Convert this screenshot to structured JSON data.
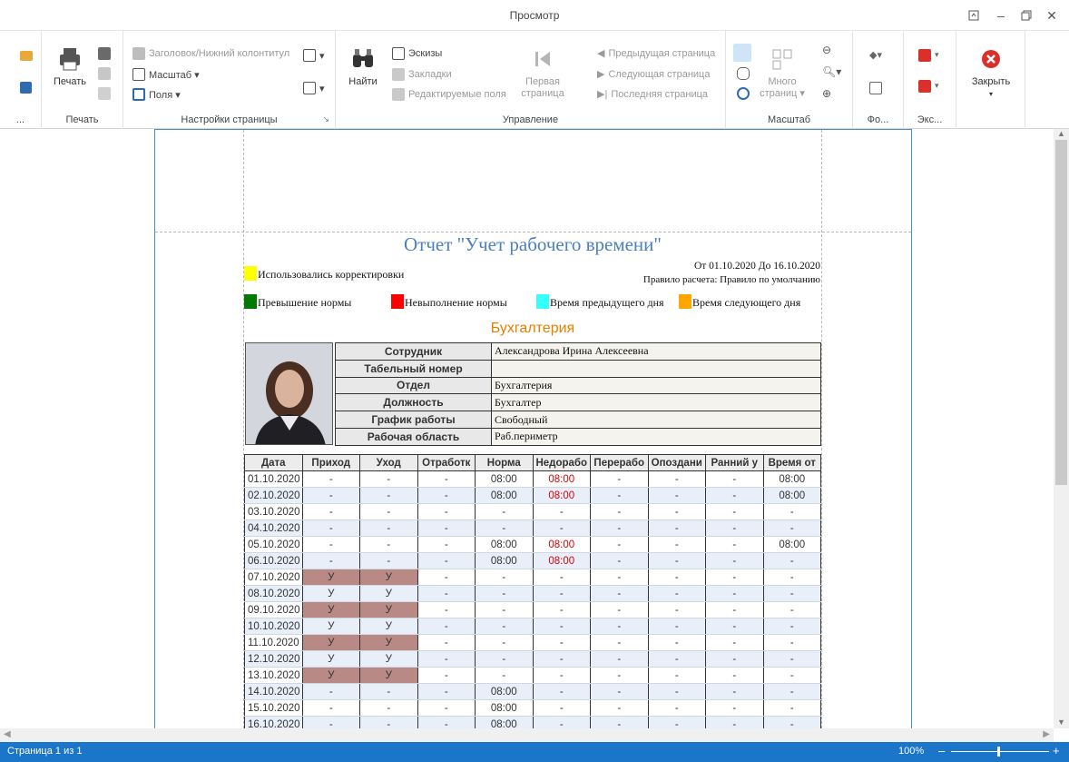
{
  "window": {
    "title": "Просмотр"
  },
  "ribbon": {
    "print_group": {
      "print_label": "Печать",
      "group_label": "Печать",
      "misc_label": "..."
    },
    "page_setup": {
      "header_footer": "Заголовок/Нижний колонтитул",
      "scale": "Масштаб ▾",
      "margins": "Поля ▾",
      "group_label": "Настройки страницы"
    },
    "nav": {
      "find": "Найти",
      "thumbnails": "Эскизы",
      "bookmarks": "Закладки",
      "editable_fields": "Редактируемые поля",
      "first_page_line1": "Первая",
      "first_page_line2": "страница",
      "prev_page": "Предыдущая страница",
      "next_page": "Следующая страница",
      "last_page": "Последняя страница",
      "group_label": "Управление"
    },
    "zoom": {
      "many_pages_line1": "Много",
      "many_pages_line2": "страниц ▾",
      "group_label": "Масштаб"
    },
    "background": {
      "group_label": "Фо..."
    },
    "export": {
      "group_label": "Экс..."
    },
    "close": {
      "label": "Закрыть"
    }
  },
  "report": {
    "title": "Отчет \"Учет рабочего времени\"",
    "period": "От 01.10.2020 До 16.10.2020",
    "rule": "Правило расчета: Правило по умолчанию",
    "legend": {
      "corrections": "Использовались корректировки",
      "over": "Превышение нормы",
      "under": "Невыполнение нормы",
      "prev_day": "Время предыдущего дня",
      "next_day": "Время следующего дня"
    },
    "colors": {
      "corrections": "#ffff00",
      "over": "#007a00",
      "under": "#ff0000",
      "prev_day": "#33ffff",
      "next_day": "#ffa500"
    },
    "department": "Бухгалтерия",
    "employee": [
      {
        "key": "Сотрудник",
        "value": "Александрова Ирина Алексеевна"
      },
      {
        "key": "Табельный номер",
        "value": ""
      },
      {
        "key": "Отдел",
        "value": "Бухгалтерия"
      },
      {
        "key": "Должность",
        "value": "Бухгалтер"
      },
      {
        "key": "График работы",
        "value": "Свободный"
      },
      {
        "key": "Рабочая область",
        "value": "Раб.периметр"
      }
    ],
    "columns": [
      "Дата",
      "Приход",
      "Уход",
      "Отработк",
      "Норма",
      "Недорабо",
      "Перерабо",
      "Опоздани",
      "Ранний у",
      "Время от"
    ],
    "rows": [
      [
        "01.10.2020",
        "-",
        "-",
        "-",
        "08:00",
        "08:00",
        "-",
        "-",
        "-",
        "08:00"
      ],
      [
        "02.10.2020",
        "-",
        "-",
        "-",
        "08:00",
        "08:00",
        "-",
        "-",
        "-",
        "08:00"
      ],
      [
        "03.10.2020",
        "-",
        "-",
        "-",
        "-",
        "-",
        "-",
        "-",
        "-",
        "-"
      ],
      [
        "04.10.2020",
        "-",
        "-",
        "-",
        "-",
        "-",
        "-",
        "-",
        "-",
        "-"
      ],
      [
        "05.10.2020",
        "-",
        "-",
        "-",
        "08:00",
        "08:00",
        "-",
        "-",
        "-",
        "08:00"
      ],
      [
        "06.10.2020",
        "-",
        "-",
        "-",
        "08:00",
        "08:00",
        "-",
        "-",
        "-",
        "-"
      ],
      [
        "07.10.2020",
        "У",
        "У",
        "-",
        "-",
        "-",
        "-",
        "-",
        "-",
        "-"
      ],
      [
        "08.10.2020",
        "У",
        "У",
        "-",
        "-",
        "-",
        "-",
        "-",
        "-",
        "-"
      ],
      [
        "09.10.2020",
        "У",
        "У",
        "-",
        "-",
        "-",
        "-",
        "-",
        "-",
        "-"
      ],
      [
        "10.10.2020",
        "У",
        "У",
        "-",
        "-",
        "-",
        "-",
        "-",
        "-",
        "-"
      ],
      [
        "11.10.2020",
        "У",
        "У",
        "-",
        "-",
        "-",
        "-",
        "-",
        "-",
        "-"
      ],
      [
        "12.10.2020",
        "У",
        "У",
        "-",
        "-",
        "-",
        "-",
        "-",
        "-",
        "-"
      ],
      [
        "13.10.2020",
        "У",
        "У",
        "-",
        "-",
        "-",
        "-",
        "-",
        "-",
        "-"
      ],
      [
        "14.10.2020",
        "-",
        "-",
        "-",
        "08:00",
        "-",
        "-",
        "-",
        "-",
        "-"
      ],
      [
        "15.10.2020",
        "-",
        "-",
        "-",
        "08:00",
        "-",
        "-",
        "-",
        "-",
        "-"
      ],
      [
        "16.10.2020",
        "-",
        "-",
        "-",
        "08:00",
        "-",
        "-",
        "-",
        "-",
        "-"
      ]
    ]
  },
  "status": {
    "page": "Страница 1 из 1",
    "zoom": "100%"
  }
}
